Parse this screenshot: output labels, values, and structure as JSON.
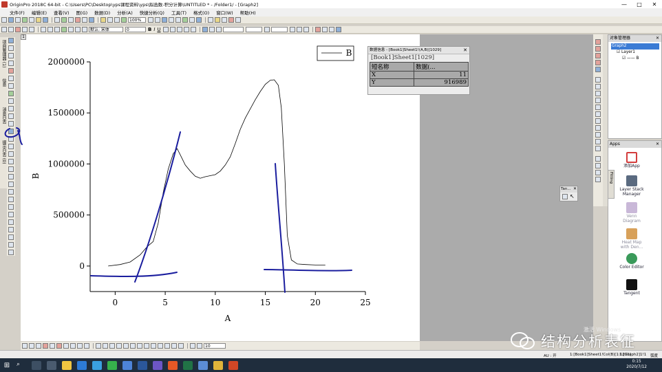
{
  "window": {
    "title": "OriginPro 2018C 64-bit - C:\\Users\\PC\\Desktop\\yps课程资料\\yps\\拟函数-积分计算\\UNTITLED * - /Folder1/ - [Graph2]",
    "controls": [
      "—",
      "□",
      "✕"
    ]
  },
  "menu": [
    "文件(F)",
    "编辑(E)",
    "查看(V)",
    "图(G)",
    "数据(D)",
    "分析(A)",
    "快捷分析(Q)",
    "工具(T)",
    "格式(O)",
    "窗口(W)",
    "帮助(H)"
  ],
  "toolbar": {
    "zoom": "100%",
    "font_label": "默认: 宋体",
    "font_size": "0",
    "bold": "B",
    "italic": "I",
    "underline": "U",
    "bottom_size": "10"
  },
  "left_dock_tabs": [
    "项目管理器 (1)",
    "信息",
    "消息日志",
    "提示日志 (0)"
  ],
  "graph": {
    "page_number": "1",
    "legend_label": "B",
    "xlabel": "A",
    "ylabel": "B"
  },
  "chart_data": {
    "type": "line",
    "xlabel": "A",
    "ylabel": "B",
    "xlim": [
      -2.5,
      25
    ],
    "ylim": [
      -250000,
      2000000
    ],
    "xticks": [
      0,
      5,
      10,
      15,
      20,
      25
    ],
    "yticks": [
      0,
      500000,
      1000000,
      1500000,
      2000000
    ],
    "xtick_labels": [
      "0",
      "5",
      "10",
      "15",
      "20",
      "25"
    ],
    "ytick_labels": [
      "0",
      "500000",
      "1000000",
      "1500000",
      "2000000"
    ],
    "legend": "top-right",
    "series": [
      {
        "name": "B",
        "x": [
          -0.7,
          0.5,
          1.5,
          2.5,
          3.2,
          3.8,
          4.3,
          4.8,
          5.3,
          5.8,
          6.2,
          6.6,
          7.0,
          7.5,
          8.0,
          8.5,
          9.0,
          9.5,
          10.0,
          10.5,
          11.0,
          11.5,
          12.0,
          12.5,
          13.0,
          13.5,
          14.0,
          14.5,
          15.0,
          15.5,
          15.9,
          16.3,
          16.6,
          16.9,
          17.2,
          17.6,
          18.2,
          19.0,
          20.0,
          21.0
        ],
        "y": [
          0,
          15000,
          40000,
          110000,
          190000,
          240000,
          420000,
          720000,
          950000,
          1100000,
          1150000,
          1070000,
          990000,
          930000,
          880000,
          860000,
          875000,
          885000,
          895000,
          930000,
          990000,
          1070000,
          1200000,
          1340000,
          1450000,
          1540000,
          1630000,
          1710000,
          1780000,
          1820000,
          1825000,
          1770000,
          1550000,
          1000000,
          300000,
          60000,
          20000,
          15000,
          10000,
          10000
        ]
      }
    ],
    "annotations": [
      "hand-drawn tangent lines (blue pen)"
    ]
  },
  "data_info": {
    "title": "数据信息 - [Book1]Sheet1!(A,B)[1029]",
    "path": "[Book1]Sheet1[1029]",
    "headers": [
      "短名称",
      "数据(..."
    ],
    "rows": [
      [
        "X",
        "11"
      ],
      [
        "Y",
        "916989"
      ]
    ]
  },
  "tangent_tool": {
    "title": "Tan..."
  },
  "object_manager": {
    "title": "对象管理器",
    "items": [
      "Graph2",
      "Layer1",
      "B"
    ]
  },
  "apps": {
    "title": "Apps",
    "side_tab": "Fitting",
    "items": [
      {
        "label": "添加App",
        "color": "#d33c3c"
      },
      {
        "label": "Layer Stack Manager",
        "color": "#5a6a80"
      },
      {
        "label": "Venn Diagram",
        "color": "#c9b8d8"
      },
      {
        "label": "Heat Map with Den...",
        "color": "#d8a15a"
      },
      {
        "label": "Color Editor",
        "color": "#3a9a5a"
      },
      {
        "label": "Tangent",
        "color": "#111111"
      }
    ]
  },
  "status": {
    "au": "AU : 开",
    "cell": "1:[Book1]Sheet1!Col(B)[1:1201]",
    "graph": "1:[Graph2]1!1",
    "angle": "弧度"
  },
  "taskbar": {
    "time": "0:15",
    "date": "2020/7/12"
  },
  "watermark": {
    "text": "结构分析表征",
    "activate": "激活 Windows"
  }
}
